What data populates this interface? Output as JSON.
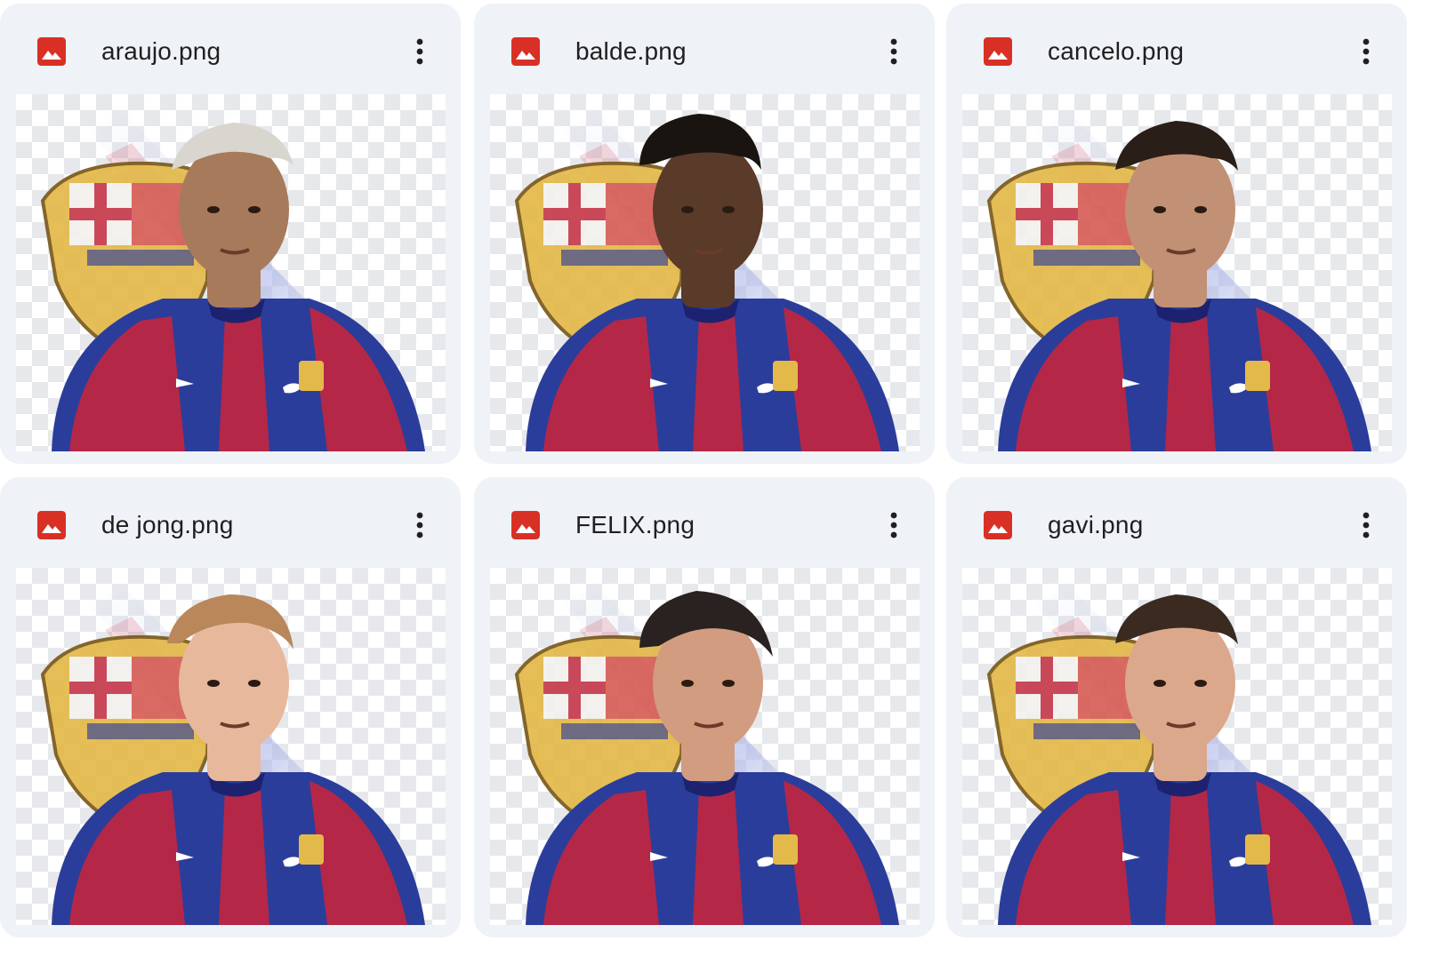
{
  "files": [
    {
      "name": "araujo.png",
      "thumbnail": "player-photo",
      "skin": "#a87a5c",
      "hair": "#d9d6cf",
      "hair_style": "bleached"
    },
    {
      "name": "balde.png",
      "thumbnail": "player-photo",
      "skin": "#5a3a28",
      "hair": "#1a1410",
      "hair_style": "curly"
    },
    {
      "name": "cancelo.png",
      "thumbnail": "player-photo",
      "skin": "#c29074",
      "hair": "#2a1e18",
      "hair_style": "short"
    },
    {
      "name": "de jong.png",
      "thumbnail": "player-photo",
      "skin": "#e8b89c",
      "hair": "#b9875a",
      "hair_style": "swept"
    },
    {
      "name": "FELIX.png",
      "thumbnail": "player-photo",
      "skin": "#d19c80",
      "hair": "#2a2220",
      "hair_style": "messy"
    },
    {
      "name": "gavi.png",
      "thumbnail": "player-photo",
      "skin": "#dca88c",
      "hair": "#3a2a20",
      "hair_style": "short"
    }
  ],
  "icons": {
    "file_type": "image-file-icon",
    "menu": "more-vert-icon"
  },
  "colors": {
    "card_bg": "#eff2f7",
    "file_icon": "#d93025",
    "text": "#1f1f1f",
    "kit_blue": "#2b3d9a",
    "kit_red": "#b52747",
    "crest_gold": "#e3b94a"
  }
}
